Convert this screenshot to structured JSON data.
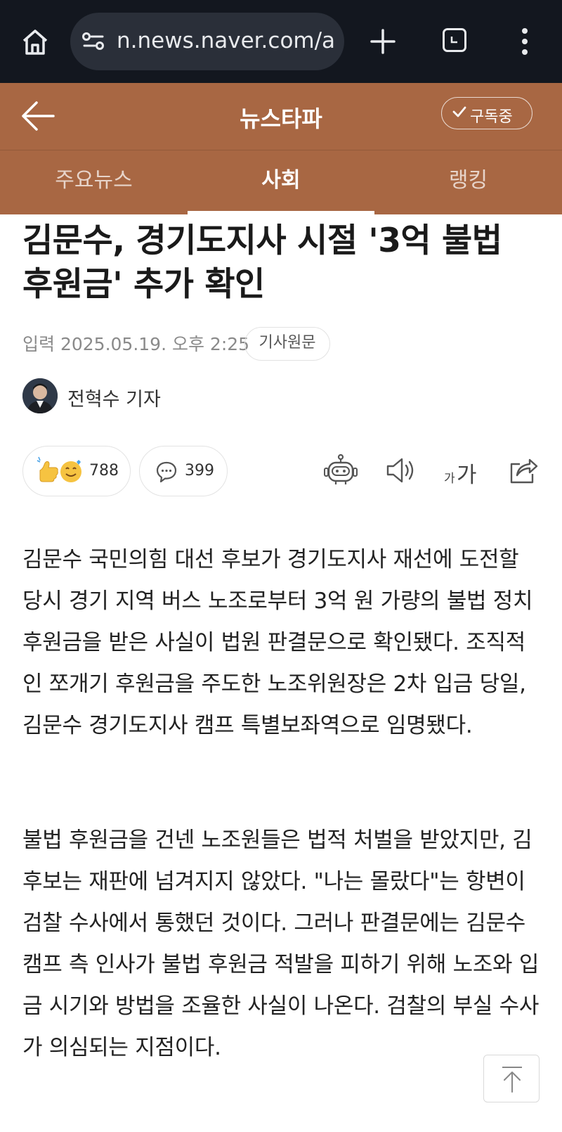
{
  "browser": {
    "url": "n.news.naver.com/a"
  },
  "header": {
    "title": "뉴스타파",
    "subscribe_label": "구독중"
  },
  "nav": {
    "tabs": [
      {
        "label": "주요뉴스",
        "active": false
      },
      {
        "label": "사회",
        "active": true
      },
      {
        "label": "랭킹",
        "active": false
      }
    ]
  },
  "article": {
    "title": "김문수, 경기도지사 시절 '3억 불법 후원금' 추가 확인",
    "date": "입력 2025.05.19. 오후 2:25",
    "original_label": "기사원문",
    "reporter": "전혁수 기자",
    "reactions_count": "788",
    "comments_count": "399",
    "font_small": "가",
    "font_big": "가",
    "paragraph1": "김문수 국민의힘 대선 후보가 경기도지사 재선에 도전할 당시 경기 지역 버스 노조로부터 3억 원 가량의 불법 정치후원금을 받은 사실이 법원 판결문으로 확인됐다. 조직적인 쪼개기 후원금을 주도한 노조위원장은 2차 입금 당일, 김문수 경기도지사 캠프 특별보좌역으로 임명됐다.",
    "paragraph2": "불법 후원금을 건넨 노조원들은 법적 처벌을 받았지만, 김 후보는 재판에 넘겨지지 않았다. \"나는 몰랐다\"는 항변이 검찰 수사에서 통했던 것이다. 그러나 판결문에는 김문수 캠프 측 인사가 불법 후원금 적발을 피하기 위해 노조와 입금 시기와 방법을 조율한 사실이 나온다. 검찰의 부실 수사가 의심되는 지점이다."
  },
  "icons": [
    "home-icon",
    "site-info-icon",
    "plus-icon",
    "tabs-icon",
    "more-vert-icon",
    "back-arrow-icon",
    "check-icon",
    "reaction-emoji-icon",
    "comment-icon",
    "ai-summary-robot-icon",
    "speaker-icon",
    "font-size-icon",
    "share-icon",
    "arrow-up-icon"
  ],
  "colors": {
    "browser_bar": "#13171f",
    "header_brand": "#a86743",
    "text": "#222222"
  }
}
